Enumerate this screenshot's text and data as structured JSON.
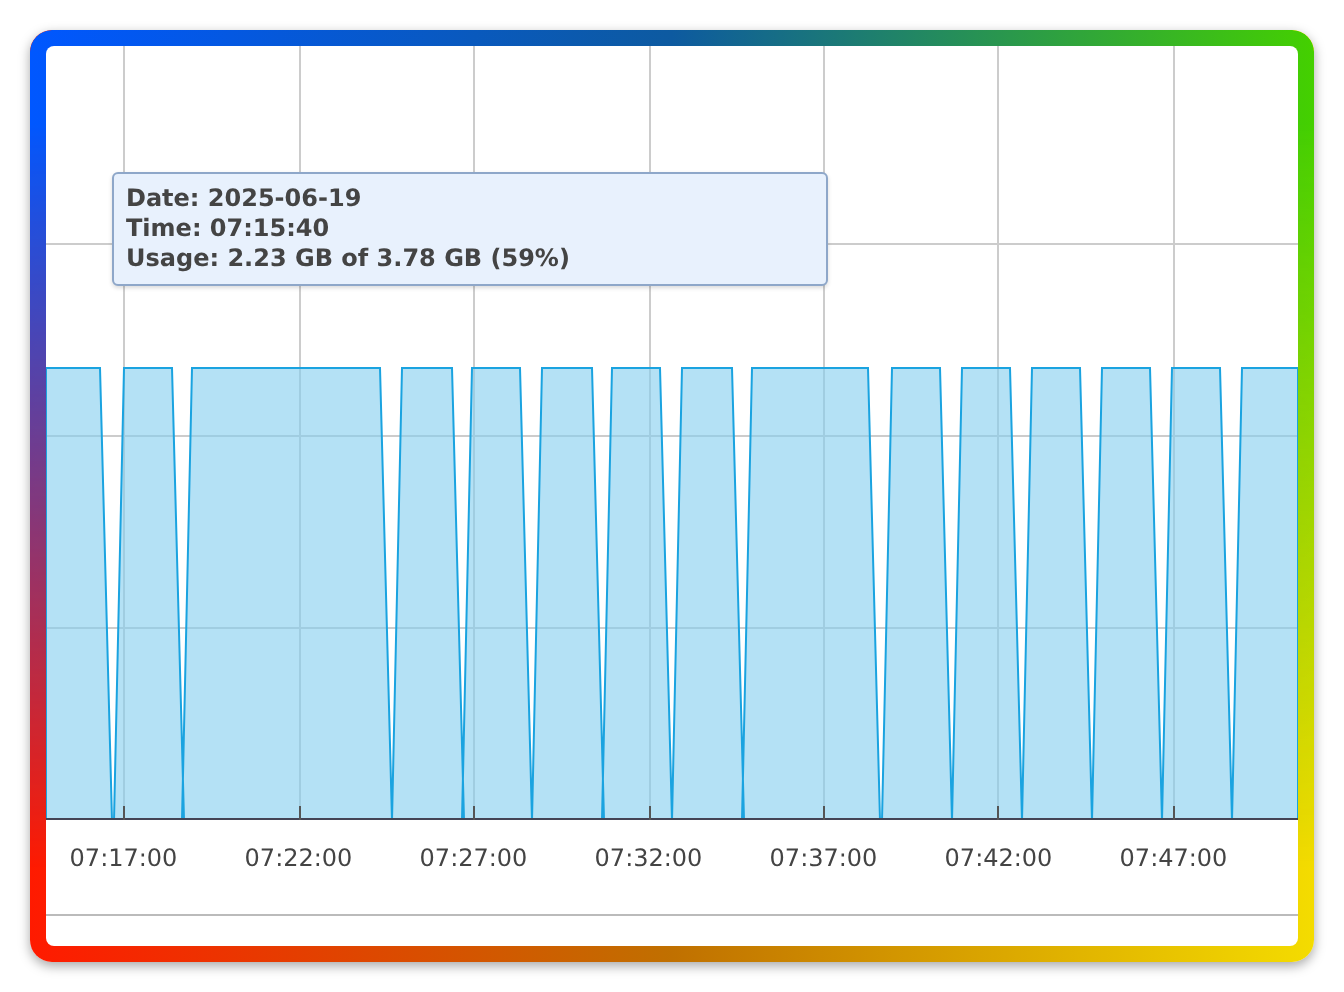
{
  "chart": {
    "tooltip": {
      "lines": [
        "Date: 2025-06-19",
        "Time: 07:15:40",
        "Usage: 2.23 GB of 3.78 GB (59%)"
      ]
    },
    "x_axis": {
      "labels": [
        "07:17:00",
        "07:22:00",
        "07:27:00",
        "07:32:00",
        "07:37:00",
        "07:42:00",
        "07:47:00"
      ]
    }
  }
}
